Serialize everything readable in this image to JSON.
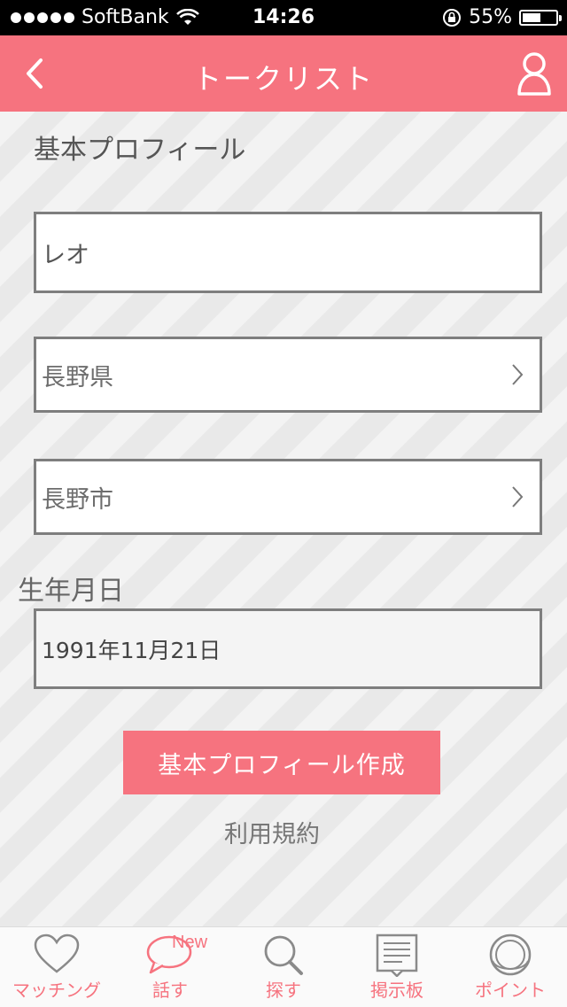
{
  "status_bar": {
    "carrier": "SoftBank",
    "time": "14:26",
    "battery_percent": "55%",
    "battery_level": 0.55
  },
  "nav": {
    "title": "トークリスト",
    "back_icon": "back-chevron-icon",
    "profile_icon": "user-icon"
  },
  "form": {
    "section_title": "基本プロフィール",
    "name_value": "レオ",
    "prefecture_value": "長野県",
    "city_value": "長野市",
    "birth_label": "生年月日",
    "birth_value": "1991年11月21日",
    "submit_label": "基本プロフィール作成",
    "terms_label": "利用規約"
  },
  "tabs": [
    {
      "label": "マッチング",
      "icon": "heart-icon"
    },
    {
      "label": "話す",
      "icon": "speech-bubble-icon",
      "badge": "New"
    },
    {
      "label": "探す",
      "icon": "search-icon"
    },
    {
      "label": "掲示板",
      "icon": "board-icon"
    },
    {
      "label": "ポイント",
      "icon": "coin-icon"
    }
  ],
  "colors": {
    "accent": "#f6737f",
    "status_bar": "#000000",
    "background": "#efefef"
  }
}
